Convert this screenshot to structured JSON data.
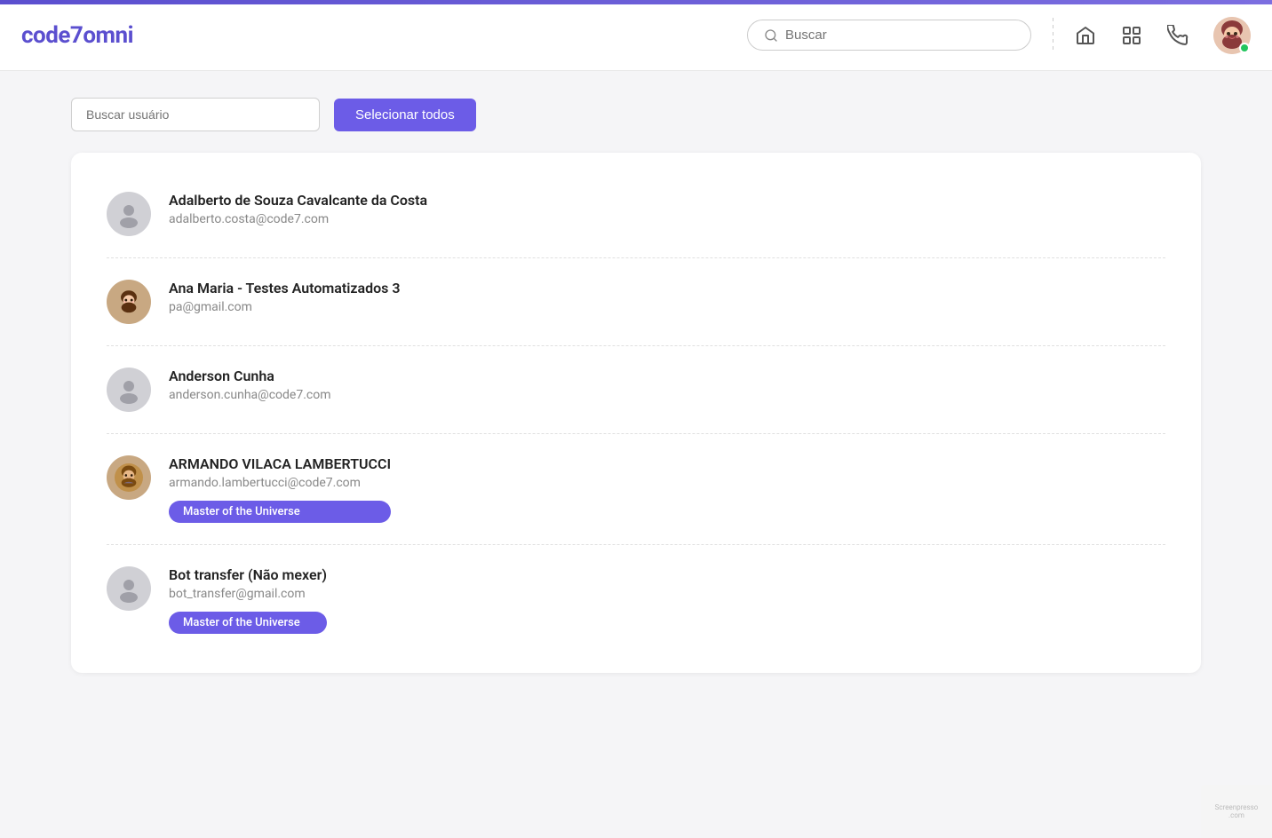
{
  "topbar": {
    "logo_prefix": "code",
    "logo_number": "7",
    "logo_suffix": "omni",
    "search_placeholder": "Buscar"
  },
  "toolbar": {
    "user_search_placeholder": "Buscar usuário",
    "select_all_label": "Selecionar todos"
  },
  "users": [
    {
      "name": "Adalberto de Souza Cavalcante da Costa",
      "email": "adalberto.costa@code7.com",
      "avatar_type": "default",
      "badges": []
    },
    {
      "name": "Ana Maria - Testes Automatizados 3",
      "email": "pa@gmail.com",
      "avatar_type": "anime",
      "badges": []
    },
    {
      "name": "Anderson Cunha",
      "email": "anderson.cunha@code7.com",
      "avatar_type": "default",
      "badges": []
    },
    {
      "name": "ARMANDO VILACA LAMBERTUCCI",
      "email": "armando.lambertucci@code7.com",
      "avatar_type": "anime",
      "badges": [
        "Master of the Universe"
      ]
    },
    {
      "name": "Bot transfer (Não mexer)",
      "email": "bot_transfer@gmail.com",
      "avatar_type": "default",
      "badges": [
        "Master of the Universe"
      ]
    }
  ],
  "icons": {
    "home": "🏠",
    "reports": "📊",
    "phone": "📞"
  }
}
